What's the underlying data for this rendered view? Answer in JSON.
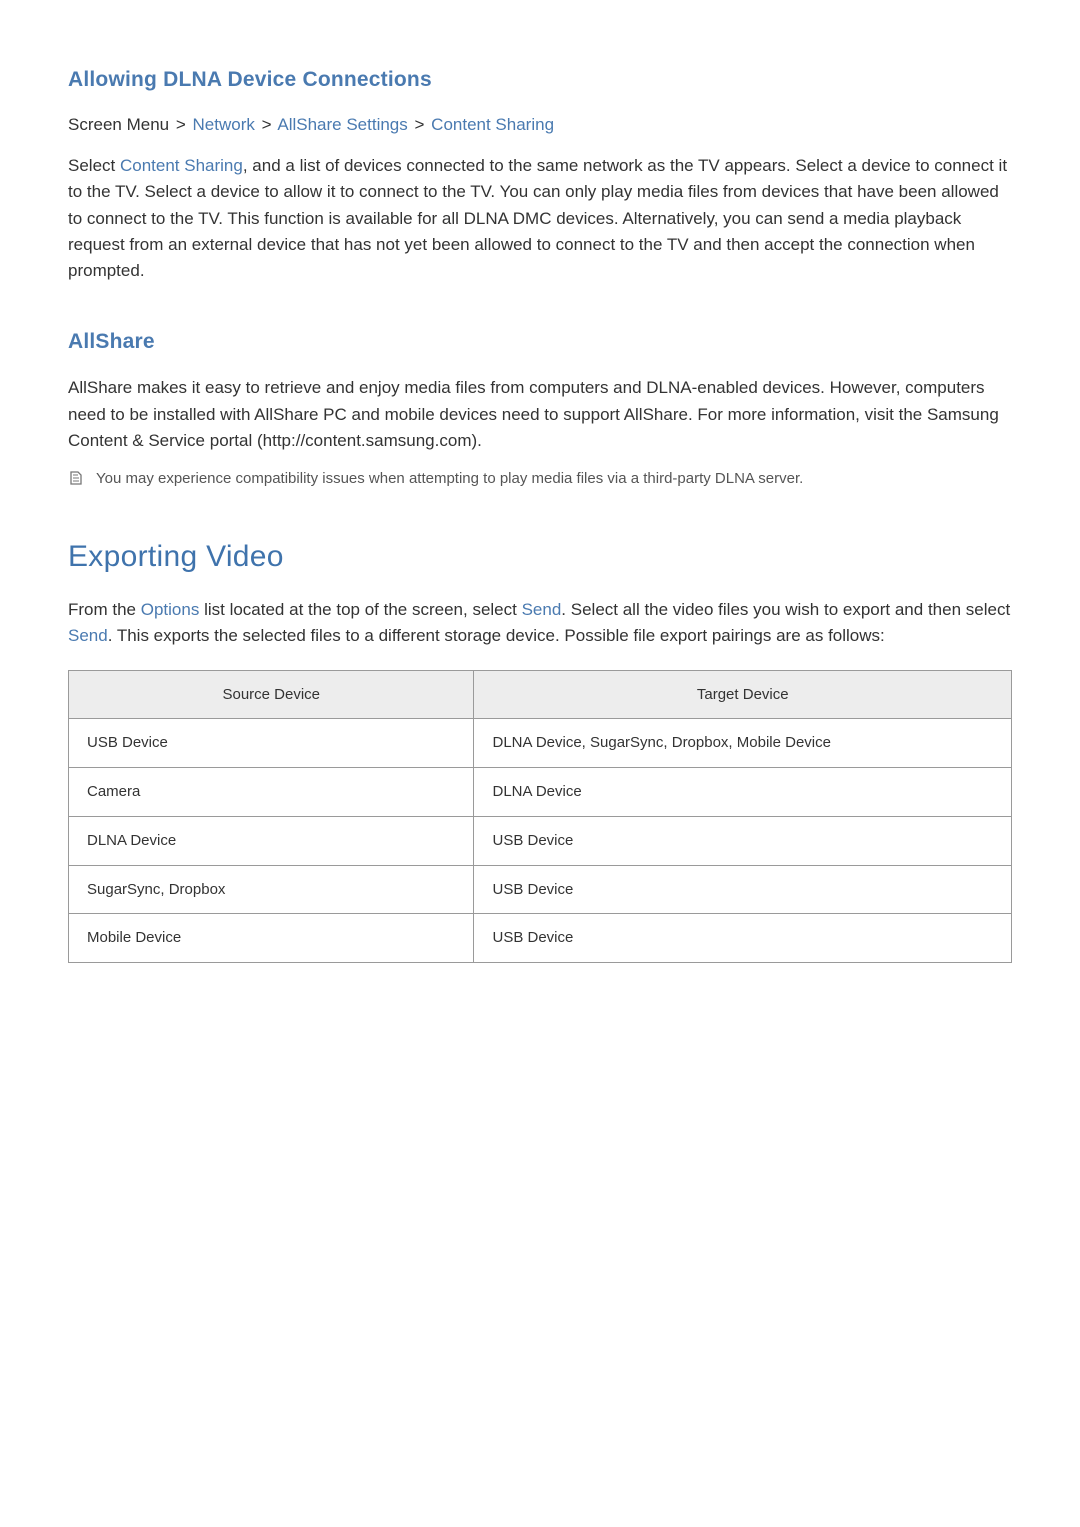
{
  "section1": {
    "heading": "Allowing DLNA Device Connections",
    "breadcrumb": {
      "prefix": "Screen Menu",
      "sep": ">",
      "links": [
        "Network",
        "AllShare Settings",
        "Content Sharing"
      ]
    },
    "body": {
      "pre1": "Select ",
      "link1": "Content Sharing",
      "post1": ", and a list of devices connected to the same network as the TV appears. Select a device to connect it to the TV. Select a device to allow it to connect to the TV. You can only play media files from devices that have been allowed to connect to the TV. This function is available for all DLNA DMC devices. Alternatively, you can send a media playback request from an external device that has not yet been allowed to connect to the TV and then accept the connection when prompted."
    }
  },
  "section2": {
    "heading": "AllShare",
    "body": "AllShare makes it easy to retrieve and enjoy media files from computers and DLNA-enabled devices. However, computers need to be installed with AllShare PC and mobile devices need to support AllShare. For more information, visit the Samsung Content & Service portal (http://content.samsung.com).",
    "note": "You may experience compatibility issues when attempting to play media files via a third-party DLNA server."
  },
  "section3": {
    "heading": "Exporting Video",
    "body": {
      "pre1": "From the ",
      "link1": "Options",
      "mid1": " list located at the top of the screen, select ",
      "link2": "Send",
      "mid2": ". Select all the video files you wish to export and then select ",
      "link3": "Send",
      "post": ". This exports the selected files to a different storage device. Possible file export pairings are as follows:"
    },
    "table": {
      "headers": [
        "Source Device",
        "Target Device"
      ],
      "rows": [
        [
          "USB Device",
          "DLNA Device, SugarSync, Dropbox, Mobile Device"
        ],
        [
          "Camera",
          "DLNA Device"
        ],
        [
          "DLNA Device",
          "USB Device"
        ],
        [
          "SugarSync, Dropbox",
          "USB Device"
        ],
        [
          "Mobile Device",
          "USB Device"
        ]
      ]
    }
  }
}
